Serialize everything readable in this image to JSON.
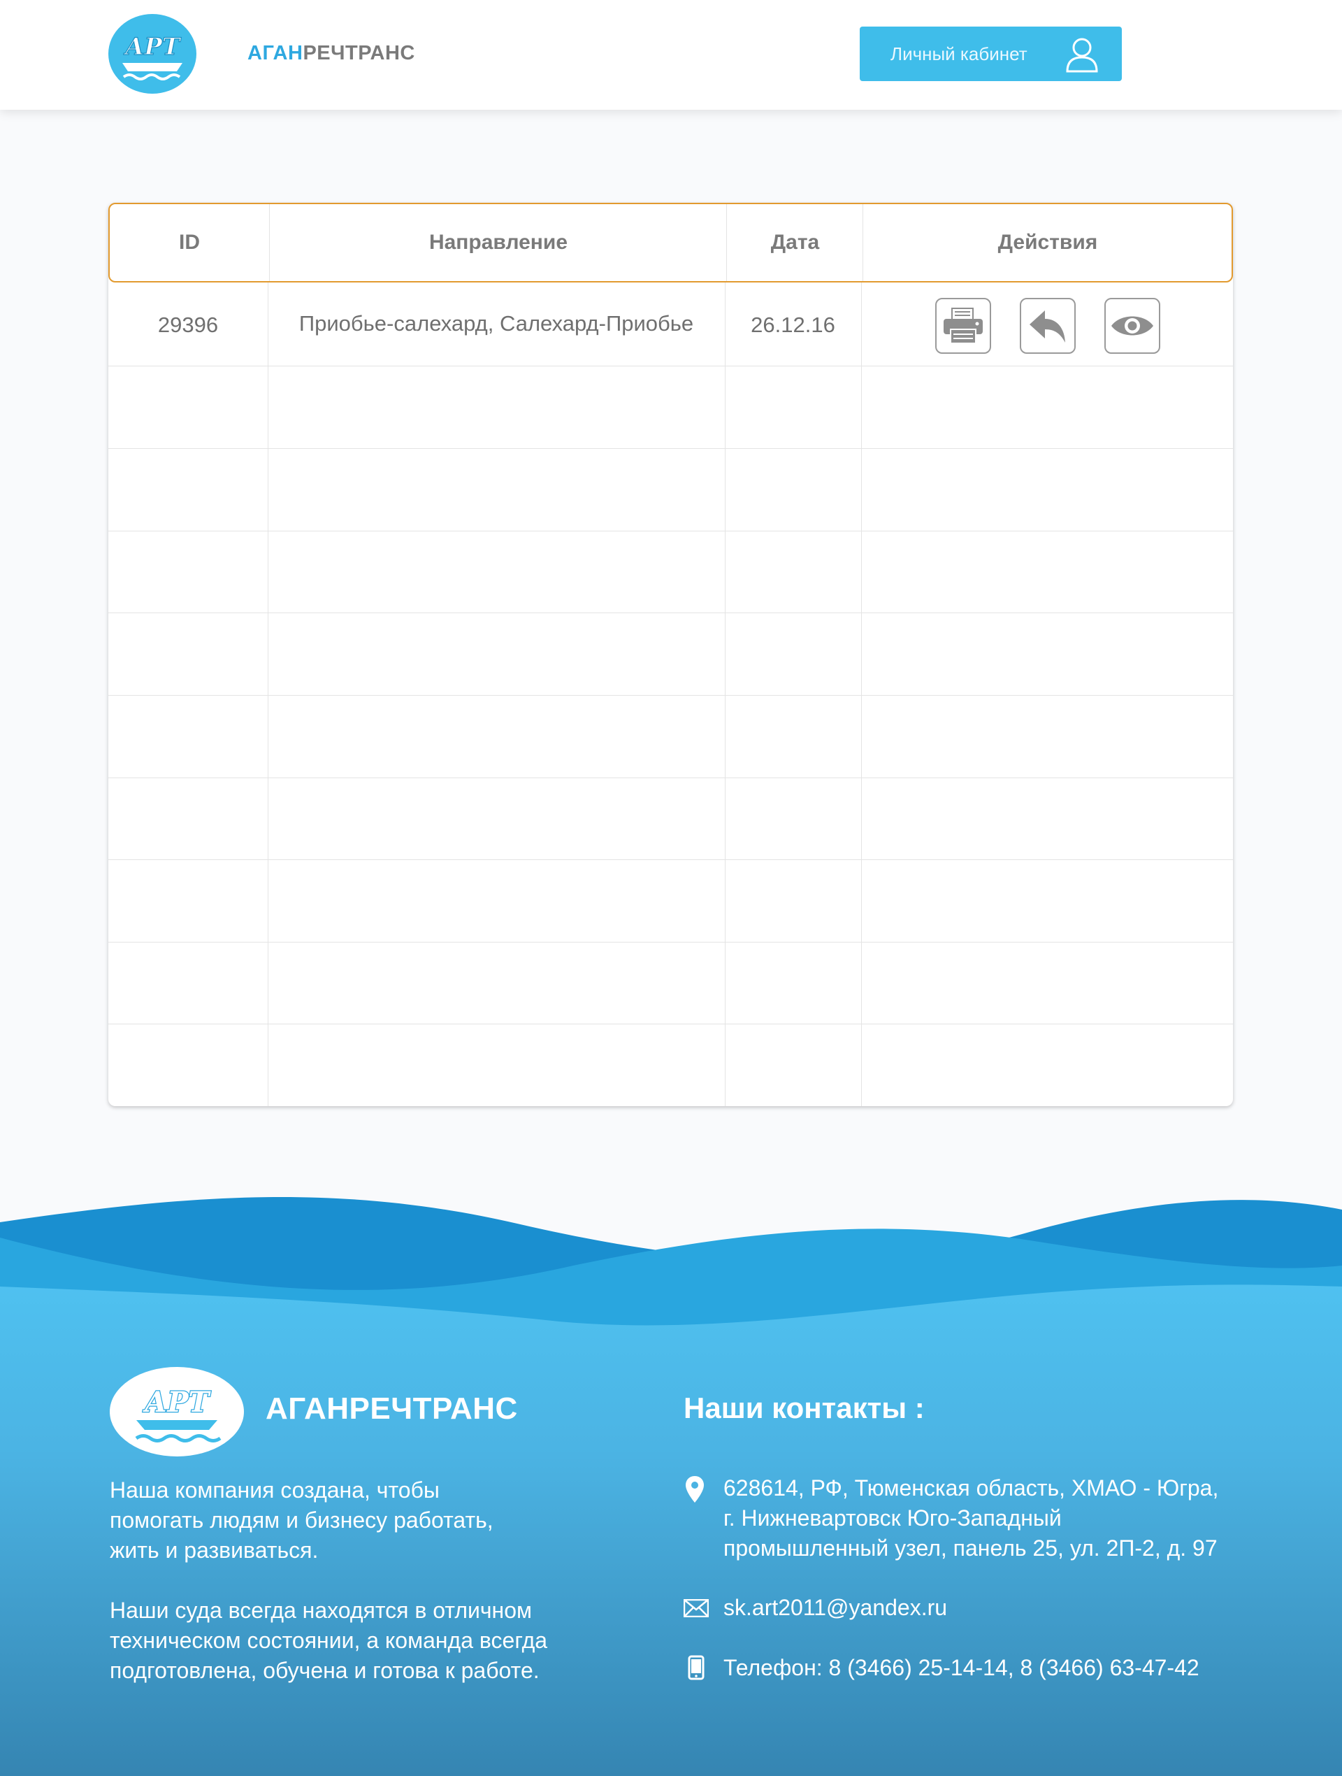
{
  "header": {
    "logo_text": "АРТ",
    "brand_part1": "АГАН",
    "brand_part2": "РЕЧТРАНС",
    "account_button_label": "Личный кабинет"
  },
  "table": {
    "columns": [
      "ID",
      "Направление",
      "Дата",
      "Действия"
    ],
    "rows": [
      {
        "id": "29396",
        "direction": "Приобье-салехард, Салехард-Приобье",
        "date": "26.12.16"
      }
    ],
    "actions": [
      "print-icon",
      "reply-icon",
      "eye-icon"
    ]
  },
  "footer": {
    "logo_text": "АРТ",
    "brand": "АГАНРЕЧТРАНС",
    "about_paragraph_1": [
      "Наша компания создана, чтобы",
      "помогать людям и бизнесу работать,",
      "жить и развиваться."
    ],
    "about_paragraph_2": [
      "Наши суда всегда находятся в отличном",
      "техническом состоянии, а команда всегда",
      "подготовлена, обучена и готова к работе."
    ],
    "contacts_title": "Наши контакты :",
    "address": [
      "628614, РФ, Тюменская область, ХМАО - Югра,",
      "г. Нижневартовск Юго-Западный",
      "промышленный узел, панель 25, ул. 2П-2, д. 97"
    ],
    "email": "sk.art2011@yandex.ru",
    "phone": "Телефон: 8 (3466) 25-14-14, 8 (3466) 63-47-42"
  },
  "colors": {
    "accent": "#3fbdea",
    "brand_blue": "#2ea8e0",
    "header_outline": "#e29a2f"
  }
}
